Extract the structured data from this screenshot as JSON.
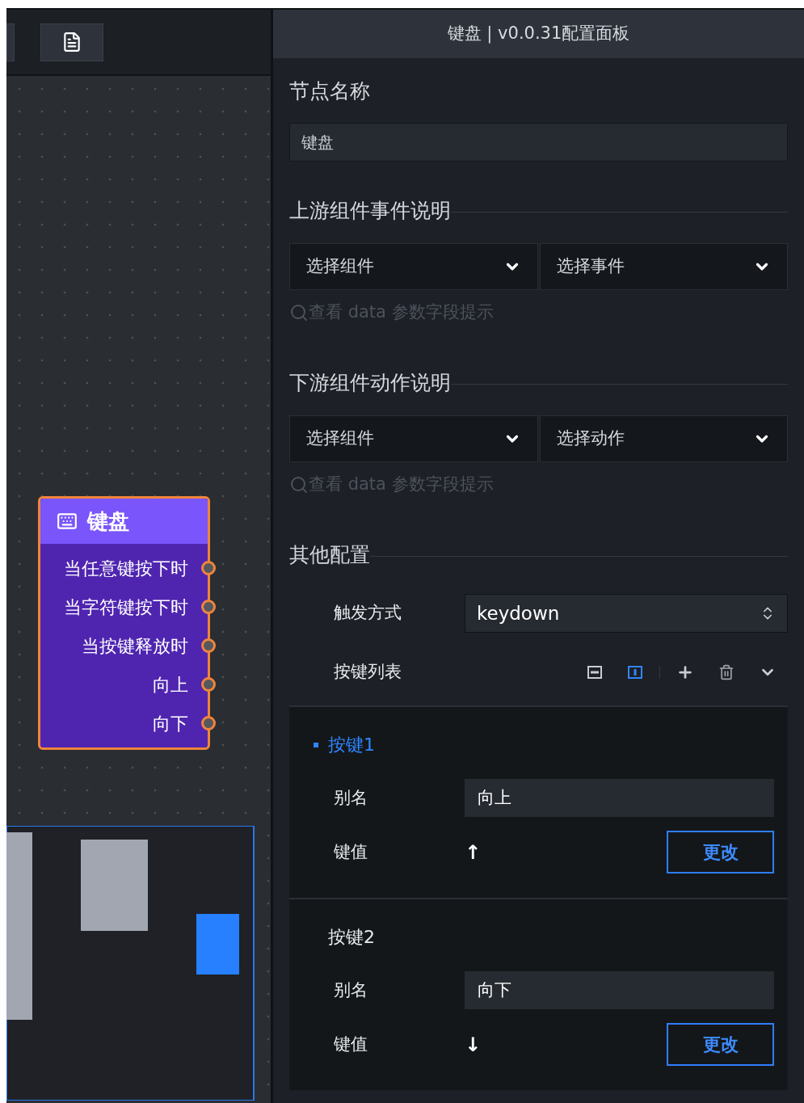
{
  "canvas": {
    "node": {
      "title": "键盘",
      "selected": true,
      "ports": [
        "当任意键按下时",
        "当字符键按下时",
        "当按键释放时",
        "向上",
        "向下"
      ]
    }
  },
  "panel": {
    "title": "键盘 | v0.0.31配置面板",
    "node_name": {
      "heading": "节点名称",
      "value": "键盘"
    },
    "upstream": {
      "heading": "上游组件事件说明",
      "selects": [
        "选择组件",
        "选择事件"
      ],
      "hint": "查看 data 参数字段提示"
    },
    "downstream": {
      "heading": "下游组件动作说明",
      "selects": [
        "选择组件",
        "选择动作"
      ],
      "hint": "查看 data 参数字段提示"
    },
    "other": {
      "heading": "其他配置",
      "trigger": {
        "label": "触发方式",
        "value": "keydown"
      },
      "key_list": {
        "label": "按键列表",
        "view_modes": [
          {
            "selected": false
          },
          {
            "selected": true
          }
        ],
        "items": [
          {
            "title": "按键1",
            "selected": true,
            "alias_label": "别名",
            "alias": "向上",
            "value_label": "键值",
            "value": "↑",
            "button": "更改"
          },
          {
            "title": "按键2",
            "selected": false,
            "alias_label": "别名",
            "alias": "向下",
            "value_label": "键值",
            "value": "↓",
            "button": "更改"
          }
        ]
      }
    }
  }
}
